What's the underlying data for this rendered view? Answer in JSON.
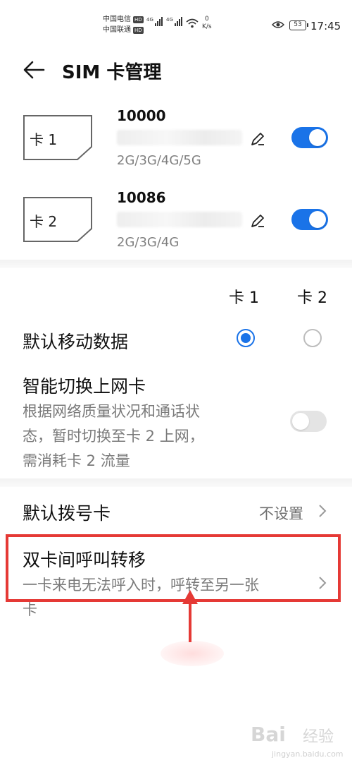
{
  "status_bar": {
    "carrier_1": "中国电信",
    "carrier_2": "中国联通",
    "hd_badge": "HD",
    "network_1": "4G",
    "network_2": "4G",
    "speed_value": "0",
    "speed_unit": "K/s",
    "battery": "53",
    "time": "17:45"
  },
  "header": {
    "title": "SIM 卡管理"
  },
  "sims": [
    {
      "card_label": "卡 1",
      "number": "10000",
      "network": "2G/3G/4G/5G",
      "enabled": true
    },
    {
      "card_label": "卡 2",
      "number": "10086",
      "network": "2G/3G/4G",
      "enabled": true
    }
  ],
  "defaults": {
    "col_card1": "卡 1",
    "col_card2": "卡 2",
    "mobile_data_label": "默认移动数据",
    "mobile_data_selected": "卡 1"
  },
  "smart_switch": {
    "title": "智能切换上网卡",
    "desc_line1": "根据网络质量状况和通话状",
    "desc_line2": "态，暂时切换至卡 2 上网，",
    "desc_line3": "需消耗卡 2 流量",
    "enabled": false
  },
  "default_dial": {
    "label": "默认拨号卡",
    "value": "不设置"
  },
  "call_forward": {
    "title": "双卡间呼叫转移",
    "desc_line1": "一卡来电无法呼入时，呼转至另一张",
    "desc_line2": "卡"
  },
  "watermark": {
    "brand": "Bai",
    "brand_cn": "经验",
    "url": "jingyan.baidu.com"
  },
  "colors": {
    "accent": "#1a73e8",
    "annotation": "#e53935"
  },
  "icons": {
    "back": "back-arrow-icon",
    "edit": "edit-pencil-icon",
    "chevron": "chevron-right-icon"
  }
}
